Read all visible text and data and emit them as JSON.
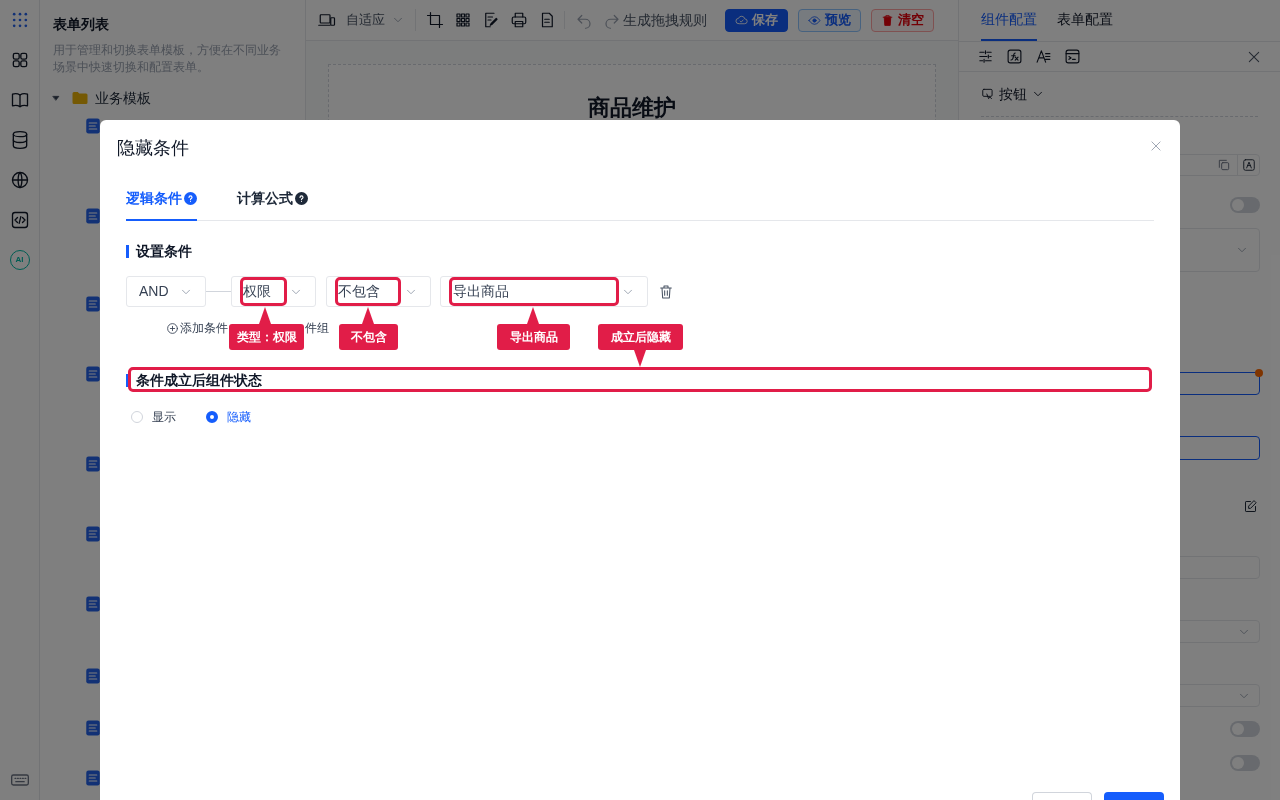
{
  "rail": {
    "ai_badge": "AI"
  },
  "sidebar": {
    "title": "表单列表",
    "description": "用于管理和切换表单模板，方便在不同业务场景中快速切换和配置表单。",
    "tree": [
      {
        "label": "业务模板",
        "expanded": true
      }
    ]
  },
  "toolbar": {
    "view_mode": "自适应",
    "rule_button": "生成拖拽规则",
    "buttons": [
      {
        "label": "保存",
        "kind": "primary"
      },
      {
        "label": "预览",
        "kind": "outline"
      },
      {
        "label": "清空",
        "kind": "danger"
      }
    ]
  },
  "canvas": {
    "form_title": "商品维护"
  },
  "right_panel": {
    "tabs": [
      {
        "label": "组件配置",
        "selected": true
      },
      {
        "label": "表单配置",
        "selected": false
      }
    ],
    "component_type": "按钮",
    "toggles": [
      {
        "on": false
      },
      {
        "on": false
      },
      {
        "on": false
      }
    ]
  },
  "dialog": {
    "title": "隐藏条件",
    "tabs": [
      {
        "label": "逻辑条件",
        "selected": true
      },
      {
        "label": "计算公式",
        "selected": false
      }
    ],
    "condition_heading": "设置条件",
    "condition": {
      "logic": "AND",
      "field": "权限",
      "operator": "不包含",
      "value": "导出商品"
    },
    "add_condition": "添加条件",
    "add_group": "件组",
    "state_heading": "条件成立后组件状态",
    "radios": [
      {
        "label": "显示",
        "selected": false
      },
      {
        "label": "隐藏",
        "selected": true
      }
    ]
  },
  "annotations": [
    {
      "label": "类型：权限",
      "kind": "above"
    },
    {
      "label": "不包含",
      "kind": "above"
    },
    {
      "label": "导出商品",
      "kind": "above"
    },
    {
      "label": "成立后隐藏",
      "kind": "below"
    }
  ]
}
